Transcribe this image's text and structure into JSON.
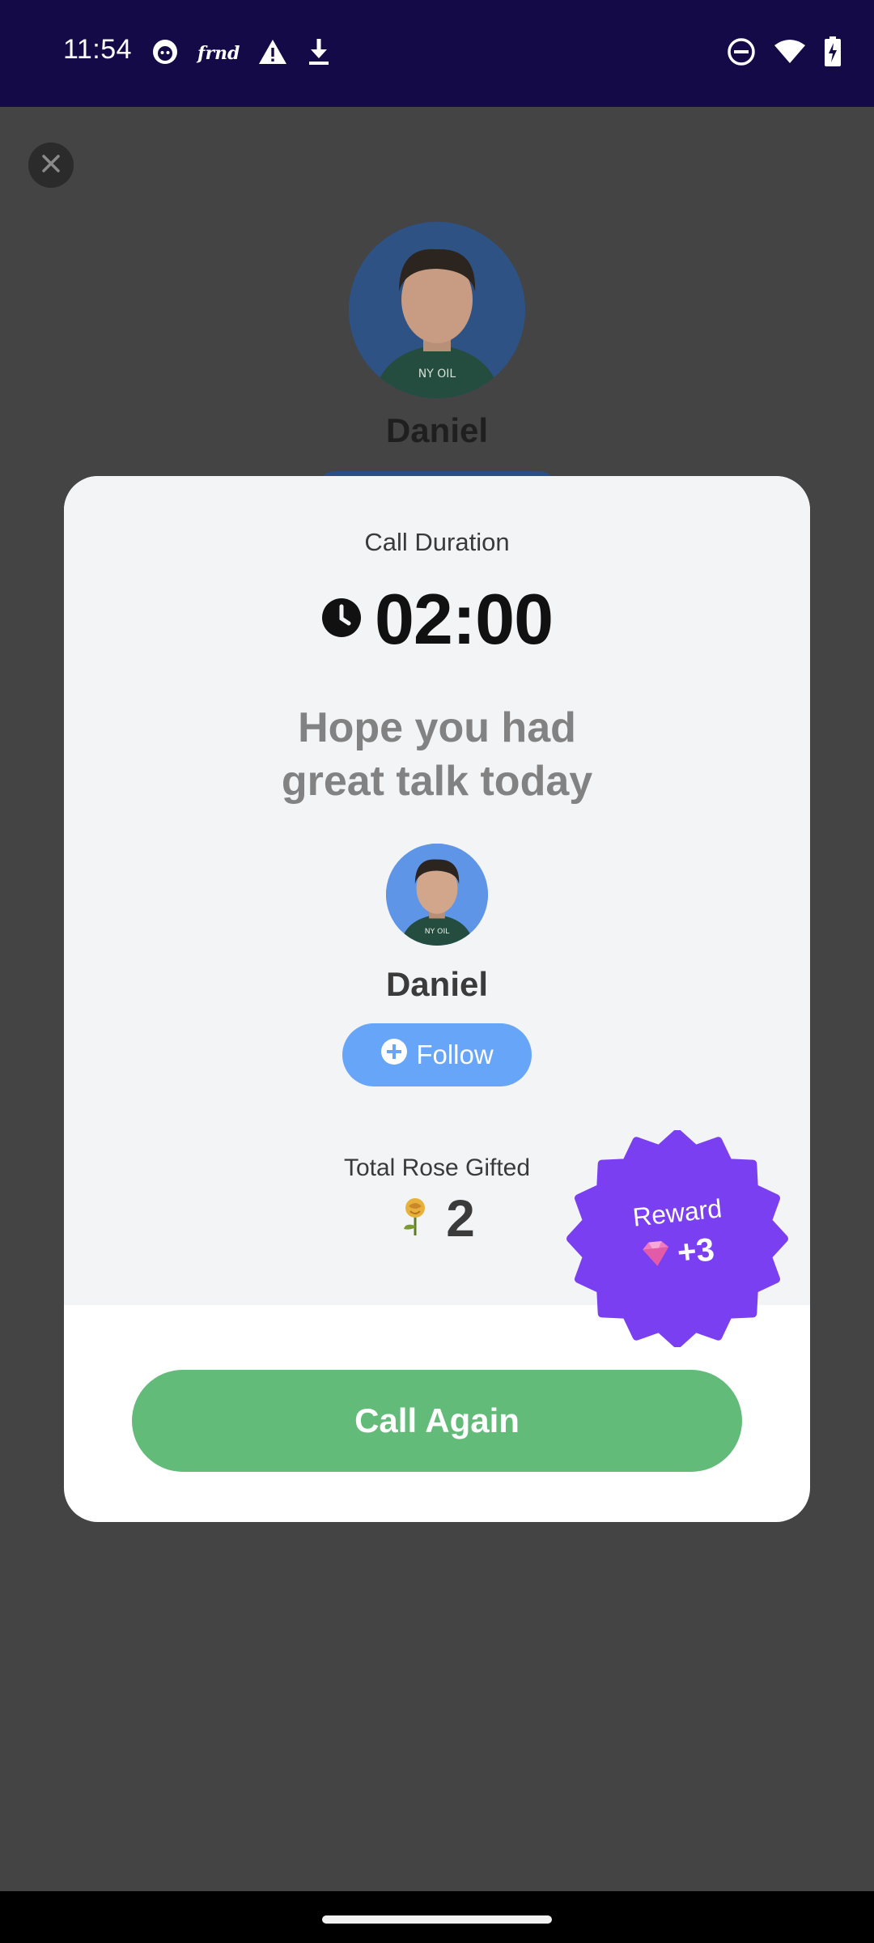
{
  "status_bar": {
    "time": "11:54",
    "left_icons": [
      "cat-app-icon",
      "frnd-icon",
      "warning-icon",
      "download-icon"
    ],
    "frnd_label": "frnd",
    "right_icons": [
      "do-not-disturb-icon",
      "wifi-icon",
      "battery-charging-icon"
    ]
  },
  "background": {
    "name": "Daniel",
    "close_icon": "close-icon"
  },
  "modal": {
    "duration_label": "Call Duration",
    "duration_value": "02:00",
    "headline_line1": "Hope you had",
    "headline_line2": "great talk today",
    "name": "Daniel",
    "follow_label": "Follow",
    "rose_label": "Total Rose Gifted",
    "rose_count": "2",
    "call_again_label": "Call Again"
  },
  "reward": {
    "label": "Reward",
    "value": "+3"
  },
  "colors": {
    "status_bar": "#140a47",
    "follow": "#66a5f7",
    "call_again": "#63bb7a",
    "reward": "#7b3ff2"
  }
}
